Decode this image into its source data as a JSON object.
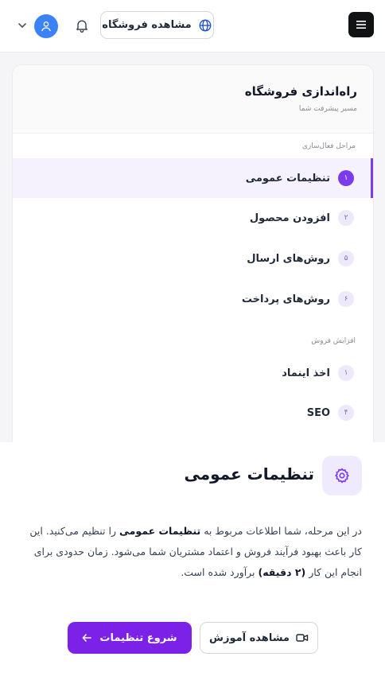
{
  "header": {
    "view_store_label": "مشاهده فروشگاه"
  },
  "setup": {
    "title": "راه‌اندازی فروشگاه",
    "subtitle": "مسیر پیشرفت شما",
    "sections": [
      {
        "label": "مراحل فعال‌سازی",
        "steps": [
          {
            "num": "۱",
            "label": "تنظیمات عمومی",
            "active": true
          },
          {
            "num": "۲",
            "label": "افزودن محصول",
            "active": false
          },
          {
            "num": "۵",
            "label": "روش‌های ارسال",
            "active": false
          },
          {
            "num": "۶",
            "label": "روش‌های پرداخت",
            "active": false
          }
        ]
      },
      {
        "label": "افزایش فروش",
        "steps": [
          {
            "num": "۱",
            "label": "اخذ اینماد",
            "active": false
          },
          {
            "num": "۴",
            "label": "SEO",
            "active": false
          }
        ]
      }
    ]
  },
  "detail": {
    "title": "تنظیمات عمومی",
    "desc_part1": "در این مرحله، شما اطلاعات مربوط به ",
    "desc_bold1": "تنظیمات عمومی",
    "desc_part2": " را تنظیم می‌کنید. این کار باعث بهبود فرآیند فروش و اعتماد مشتریان شما می‌شود. زمان حدودی برای انجام این کار ",
    "desc_bold2": "(۲ دقیقه)",
    "desc_part3": " برآورد شده است.",
    "primary_button": "شروع تنظیمات",
    "secondary_button": "مشاهده آموزش"
  },
  "colors": {
    "accent": "#7c22e8",
    "active_bg": "#f5f2fe",
    "avatar": "#3b82f6",
    "menu_button": "#111214"
  },
  "icons": {
    "menu": "menu-icon",
    "globe": "globe-icon",
    "bell": "bell-icon",
    "user": "user-icon",
    "chevron": "chevron-down-icon",
    "gear": "gear-icon",
    "arrow": "arrow-left-icon",
    "video": "video-icon"
  }
}
